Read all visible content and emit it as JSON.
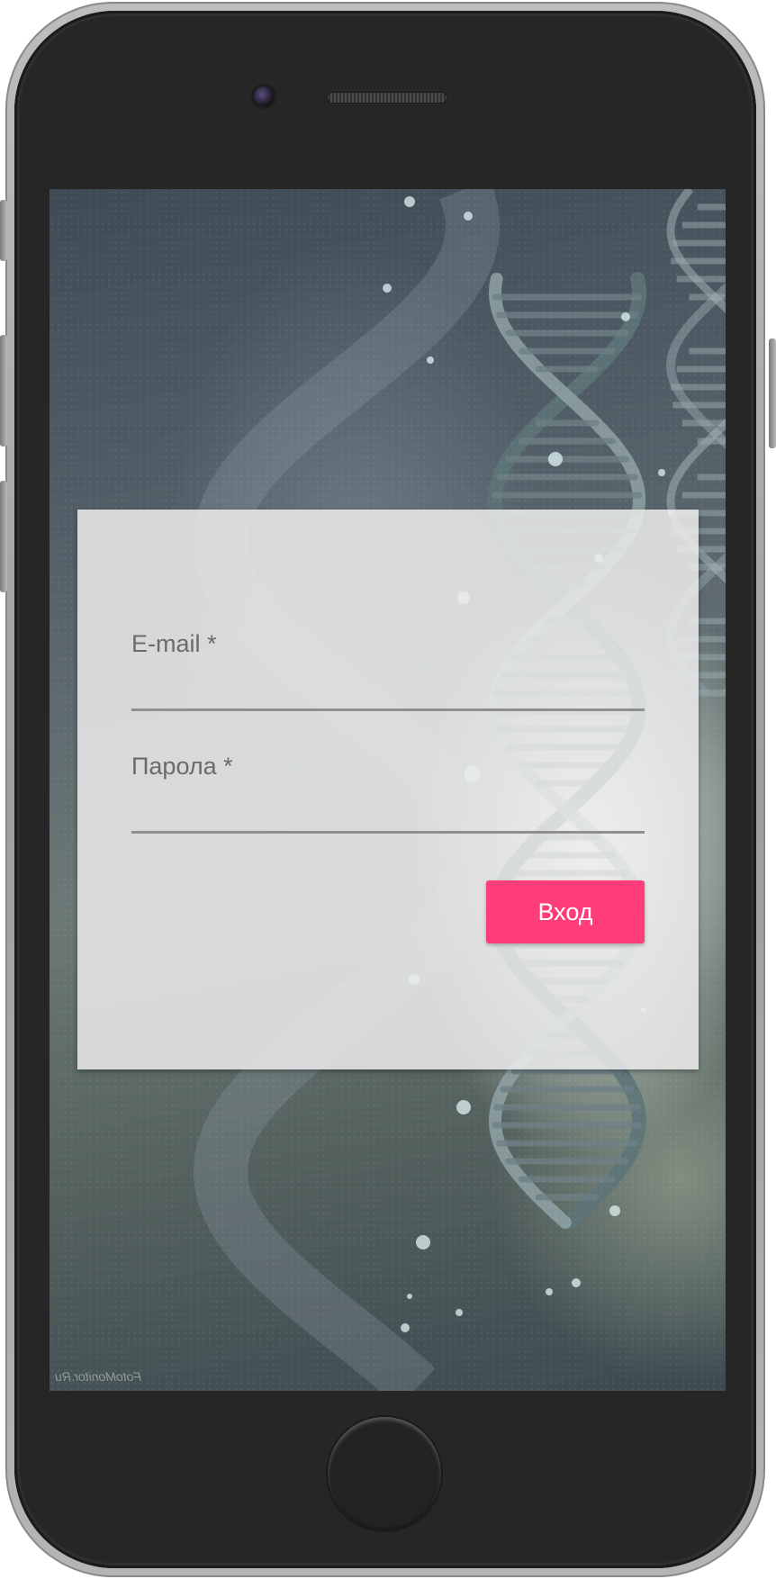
{
  "login_form": {
    "email_label": "E-mail *",
    "email_value": "",
    "password_label": "Парола *",
    "password_value": "",
    "submit_label": "Вход"
  },
  "background": {
    "watermark": "FotoMonitor.Ru"
  },
  "colors": {
    "accent": "#ff3d7a",
    "phone_body": "#262626",
    "input_underline": "#8f8f8f"
  },
  "icons": [
    "camera-icon",
    "speaker-grille",
    "home-button"
  ]
}
